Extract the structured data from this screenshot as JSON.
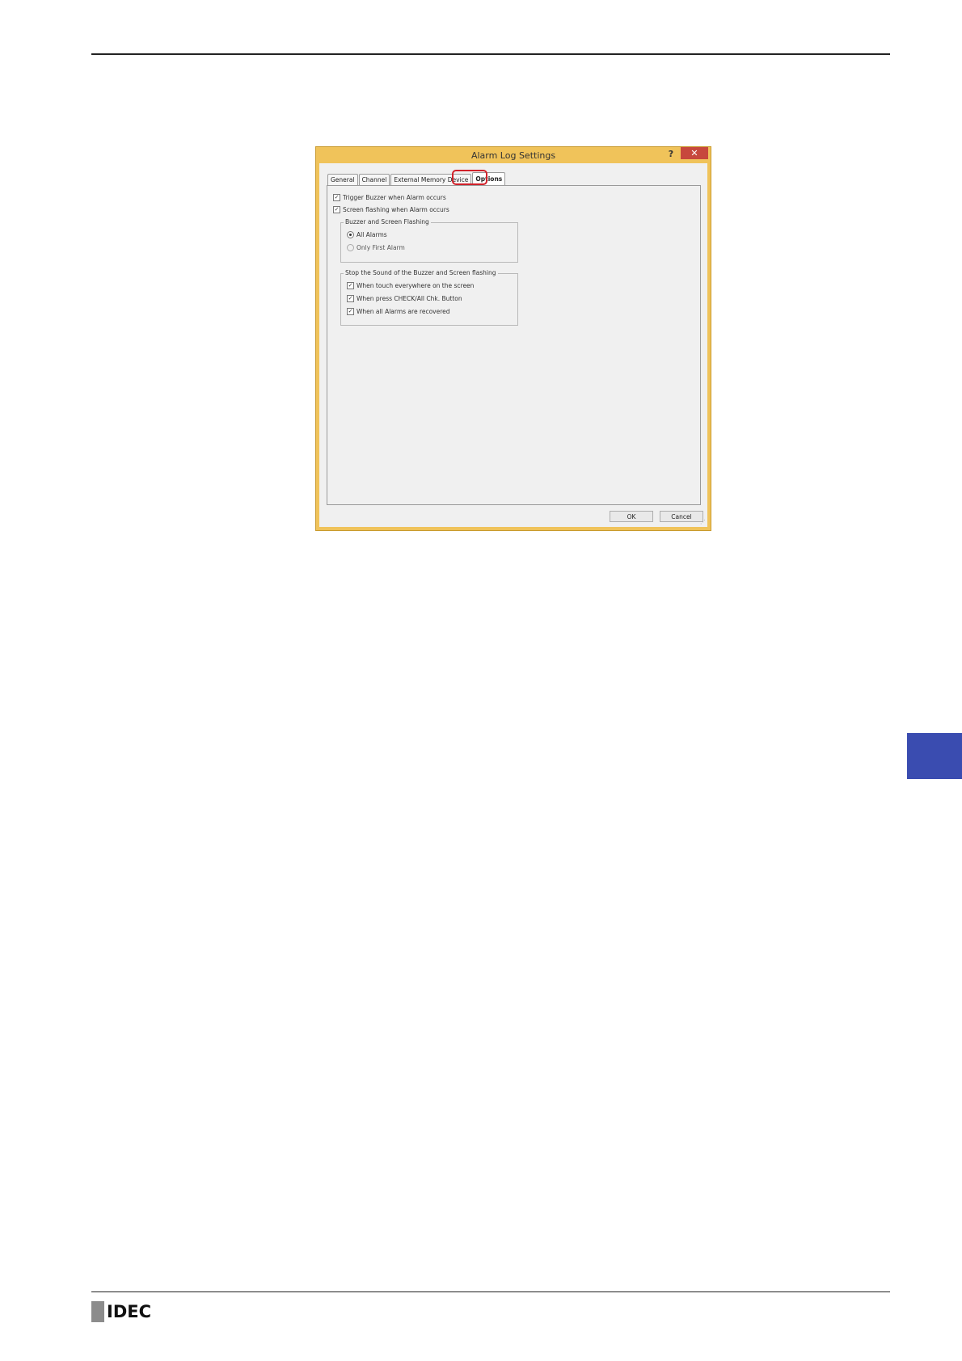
{
  "dialog": {
    "title": "Alarm Log Settings",
    "help_label": "?",
    "close_label": "✕",
    "tabs": [
      {
        "label": "General"
      },
      {
        "label": "Channel"
      },
      {
        "label": "External Memory Device"
      },
      {
        "label": "Options"
      }
    ],
    "active_tab": "Options",
    "options": {
      "trigger_buzzer": {
        "label": "Trigger Buzzer when Alarm occurs",
        "checked": true
      },
      "screen_flashing": {
        "label": "Screen flashing when Alarm occurs",
        "checked": true
      },
      "buzzer_group": {
        "label": "Buzzer and Screen Flashing",
        "all_alarms": {
          "label": "All Alarms",
          "selected": true
        },
        "only_first": {
          "label": "Only First Alarm",
          "selected": false
        }
      },
      "stop_group": {
        "label": "Stop the Sound of the Buzzer and Screen flashing",
        "touch": {
          "label": "When touch everywhere on the screen",
          "checked": true
        },
        "press": {
          "label": "When press CHECK/All Chk. Button",
          "checked": true
        },
        "recovered": {
          "label": "When all Alarms are recovered",
          "checked": true
        }
      }
    },
    "ok_label": "OK",
    "cancel_label": "Cancel"
  },
  "page": {
    "logo_text": "IDEC",
    "accent_color": "#3a4cb0",
    "highlight_color": "#d0212a"
  }
}
